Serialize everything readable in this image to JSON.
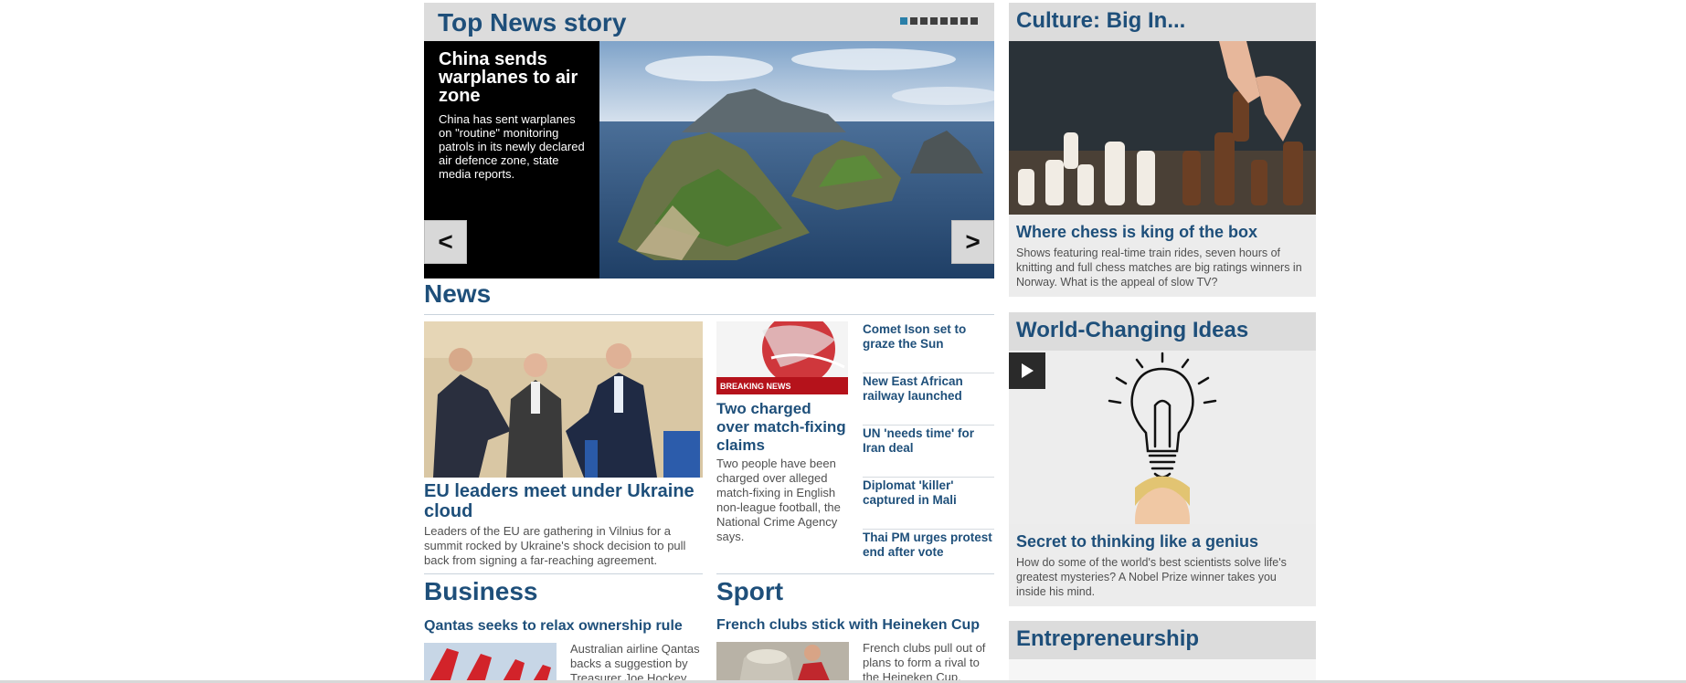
{
  "top_news": {
    "heading": "Top News story",
    "pager_count": 8,
    "pager_active": 1,
    "story_title": "China sends warplanes to air zone",
    "story_text": "China has sent warplanes on \"routine\" monitoring patrols in its newly declared air defence zone, state media reports.",
    "prev_label": "<",
    "next_label": ">"
  },
  "news": {
    "heading": "News",
    "lead_title": "EU leaders meet under Ukraine cloud",
    "lead_text": "Leaders of the EU are gathering in Vilnius for a summit rocked by Ukraine's shock decision to pull back from signing a far-reaching agreement.",
    "second_badge": "BREAKING NEWS",
    "second_title": "Two charged over match-fixing claims",
    "second_text": "Two people have been charged over alleged match-fixing in English non-league football, the National Crime Agency says.",
    "headlines": [
      "Comet Ison set to graze the Sun",
      "New East African railway launched",
      "UN 'needs time' for Iran deal",
      "Diplomat 'killer' captured in Mali",
      "Thai PM urges protest end after vote"
    ]
  },
  "business": {
    "heading": "Business",
    "title": "Qantas seeks to relax ownership rule",
    "text": "Australian airline Qantas backs a suggestion by Treasurer Joe Hockey"
  },
  "sport": {
    "heading": "Sport",
    "title": "French clubs stick with Heineken Cup",
    "text": "French clubs pull out of plans to form a rival to the Heineken Cup,"
  },
  "culture": {
    "heading": "Culture: Big In...",
    "title": "Where chess is king of the box",
    "text": "Shows featuring real-time train rides, seven hours of knitting and full chess matches are big ratings winners in Norway. What is the appeal of slow TV?"
  },
  "ideas": {
    "heading": "World-Changing Ideas",
    "title": "Secret to thinking like a genius",
    "text": "How do some of the world's best scientists solve life's greatest mysteries? A Nobel Prize winner takes you inside his mind."
  },
  "entrepreneurship": {
    "heading": "Entrepreneurship"
  },
  "colors": {
    "heading_blue": "#1e4f7a",
    "panel_gray": "#dcdcdc",
    "pager_active": "#2a7fa8"
  }
}
